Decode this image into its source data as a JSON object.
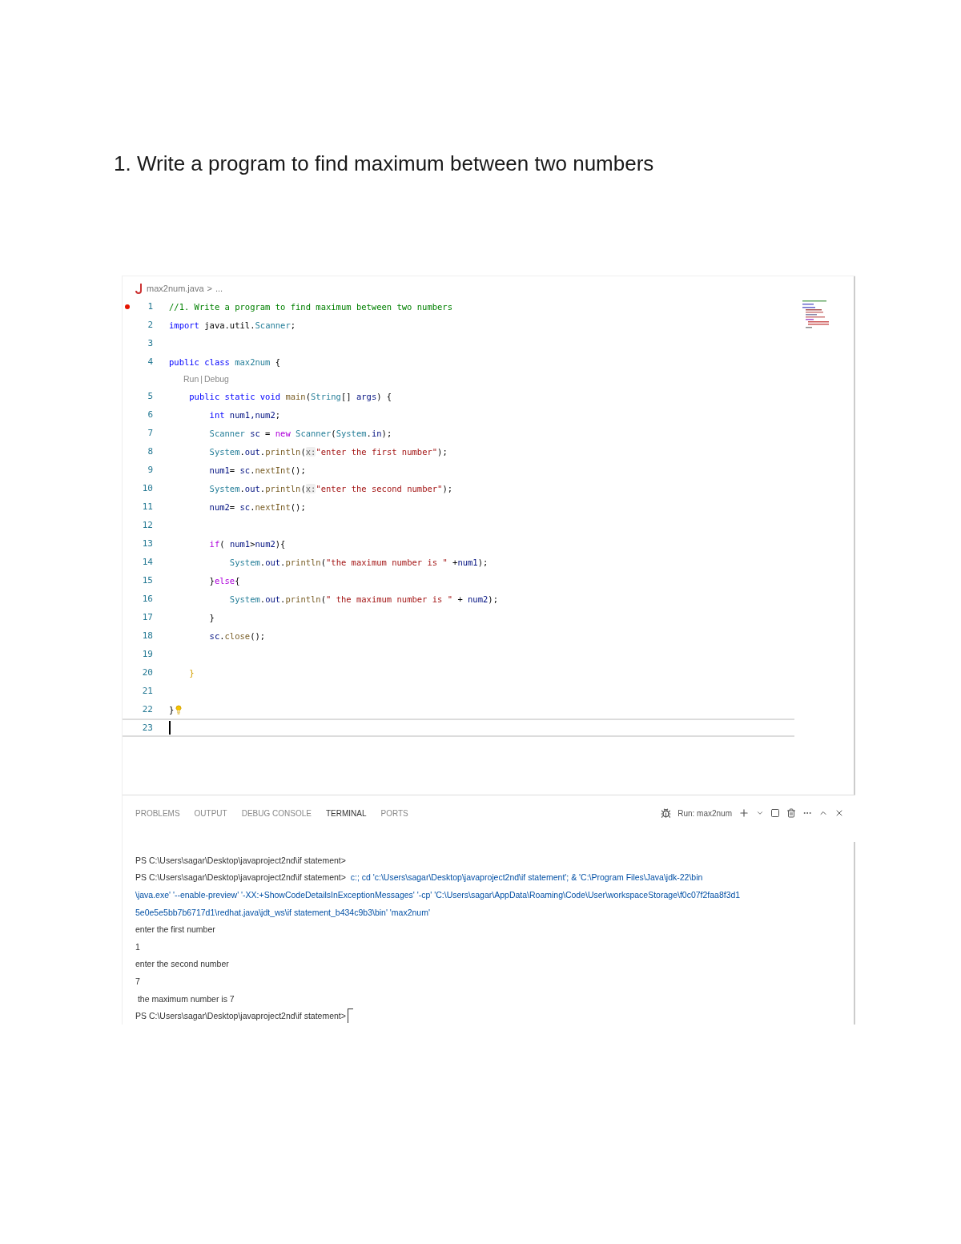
{
  "heading": "1. Write a program to find maximum between two numbers",
  "editor": {
    "breadcrumb": {
      "file": "max2num.java",
      "separator": ">",
      "rest": "..."
    },
    "lines": [
      {
        "kind": "code",
        "number": "1",
        "breakpoint": true,
        "current": false,
        "tokens": [
          {
            "kind": "comment",
            "text": "//1. Write a program to find maximum between two numbers"
          }
        ]
      },
      {
        "kind": "code",
        "number": "2",
        "breakpoint": false,
        "current": false,
        "tokens": [
          {
            "kind": "keyword",
            "text": "import"
          },
          {
            "kind": "plain",
            "text": " java.util."
          },
          {
            "kind": "type",
            "text": "Scanner"
          },
          {
            "kind": "plain",
            "text": ";"
          }
        ]
      },
      {
        "kind": "code",
        "number": "3",
        "breakpoint": false,
        "current": false
      },
      {
        "kind": "code",
        "number": "4",
        "breakpoint": false,
        "current": false,
        "tokens": [
          {
            "kind": "keyword",
            "text": "public class"
          },
          {
            "kind": "type",
            "text": " max2num"
          },
          {
            "kind": "plain",
            "text": " {"
          }
        ]
      },
      {
        "kind": "codelens",
        "links": [
          "Run",
          "Debug"
        ],
        "separator": "|"
      },
      {
        "kind": "code",
        "number": "5",
        "breakpoint": false,
        "current": false,
        "tokens": [
          {
            "kind": "keyword",
            "text": "    public static void"
          },
          {
            "kind": "function",
            "text": " main"
          },
          {
            "kind": "plain",
            "text": "("
          },
          {
            "kind": "type",
            "text": "String"
          },
          {
            "kind": "plain",
            "text": "[] "
          },
          {
            "kind": "variable",
            "text": "args"
          },
          {
            "kind": "plain",
            "text": ") {"
          }
        ]
      },
      {
        "kind": "code",
        "number": "6",
        "breakpoint": false,
        "current": false,
        "tokens": [
          {
            "kind": "keyword",
            "text": "        int"
          },
          {
            "kind": "variable",
            "text": " num1,num2"
          },
          {
            "kind": "plain",
            "text": ";"
          }
        ]
      },
      {
        "kind": "code",
        "number": "7",
        "breakpoint": false,
        "current": false,
        "tokens": [
          {
            "kind": "type",
            "text": "        Scanner"
          },
          {
            "kind": "variable",
            "text": " sc"
          },
          {
            "kind": "plain",
            "text": " = "
          },
          {
            "kind": "control",
            "text": "new"
          },
          {
            "kind": "type",
            "text": " Scanner"
          },
          {
            "kind": "plain",
            "text": "("
          },
          {
            "kind": "type",
            "text": "System"
          },
          {
            "kind": "plain",
            "text": "."
          },
          {
            "kind": "variable",
            "text": "in"
          },
          {
            "kind": "plain",
            "text": ");"
          }
        ]
      },
      {
        "kind": "code",
        "number": "8",
        "breakpoint": false,
        "current": false,
        "tokens": [
          {
            "kind": "type",
            "text": "        System"
          },
          {
            "kind": "plain",
            "text": "."
          },
          {
            "kind": "variable",
            "text": "out"
          },
          {
            "kind": "plain",
            "text": "."
          },
          {
            "kind": "function",
            "text": "println"
          },
          {
            "kind": "plain",
            "text": "("
          },
          {
            "kind": "hint",
            "text": "x:"
          },
          {
            "kind": "string",
            "text": "\"enter the first number\""
          },
          {
            "kind": "plain",
            "text": ");"
          }
        ]
      },
      {
        "kind": "code",
        "number": "9",
        "breakpoint": false,
        "current": false,
        "tokens": [
          {
            "kind": "variable",
            "text": "        num1"
          },
          {
            "kind": "plain",
            "text": "= "
          },
          {
            "kind": "variable",
            "text": "sc"
          },
          {
            "kind": "plain",
            "text": "."
          },
          {
            "kind": "function",
            "text": "nextInt"
          },
          {
            "kind": "plain",
            "text": "();"
          }
        ]
      },
      {
        "kind": "code",
        "number": "10",
        "breakpoint": false,
        "current": false,
        "tokens": [
          {
            "kind": "type",
            "text": "        System"
          },
          {
            "kind": "plain",
            "text": "."
          },
          {
            "kind": "variable",
            "text": "out"
          },
          {
            "kind": "plain",
            "text": "."
          },
          {
            "kind": "function",
            "text": "println"
          },
          {
            "kind": "plain",
            "text": "("
          },
          {
            "kind": "hint",
            "text": "x:"
          },
          {
            "kind": "string",
            "text": "\"enter the second number\""
          },
          {
            "kind": "plain",
            "text": ");"
          }
        ]
      },
      {
        "kind": "code",
        "number": "11",
        "breakpoint": false,
        "current": false,
        "tokens": [
          {
            "kind": "variable",
            "text": "        num2"
          },
          {
            "kind": "plain",
            "text": "= "
          },
          {
            "kind": "variable",
            "text": "sc"
          },
          {
            "kind": "plain",
            "text": "."
          },
          {
            "kind": "function",
            "text": "nextInt"
          },
          {
            "kind": "plain",
            "text": "();"
          }
        ]
      },
      {
        "kind": "code",
        "number": "12",
        "breakpoint": false,
        "current": false
      },
      {
        "kind": "code",
        "number": "13",
        "breakpoint": false,
        "current": false,
        "tokens": [
          {
            "kind": "control",
            "text": "        if"
          },
          {
            "kind": "plain",
            "text": "( "
          },
          {
            "kind": "variable",
            "text": "num1"
          },
          {
            "kind": "plain",
            "text": ">"
          },
          {
            "kind": "variable",
            "text": "num2"
          },
          {
            "kind": "plain",
            "text": "){"
          }
        ]
      },
      {
        "kind": "code",
        "number": "14",
        "breakpoint": false,
        "current": false,
        "tokens": [
          {
            "kind": "type",
            "text": "            System"
          },
          {
            "kind": "plain",
            "text": "."
          },
          {
            "kind": "variable",
            "text": "out"
          },
          {
            "kind": "plain",
            "text": "."
          },
          {
            "kind": "function",
            "text": "println"
          },
          {
            "kind": "plain",
            "text": "("
          },
          {
            "kind": "string",
            "text": "\"the maximum number is \""
          },
          {
            "kind": "plain",
            "text": " +"
          },
          {
            "kind": "variable",
            "text": "num1"
          },
          {
            "kind": "plain",
            "text": ");"
          }
        ]
      },
      {
        "kind": "code",
        "number": "15",
        "breakpoint": false,
        "current": false,
        "tokens": [
          {
            "kind": "plain",
            "text": "        }"
          },
          {
            "kind": "control",
            "text": "else"
          },
          {
            "kind": "plain",
            "text": "{"
          }
        ]
      },
      {
        "kind": "code",
        "number": "16",
        "breakpoint": false,
        "current": false,
        "tokens": [
          {
            "kind": "type",
            "text": "            System"
          },
          {
            "kind": "plain",
            "text": "."
          },
          {
            "kind": "variable",
            "text": "out"
          },
          {
            "kind": "plain",
            "text": "."
          },
          {
            "kind": "function",
            "text": "println"
          },
          {
            "kind": "plain",
            "text": "("
          },
          {
            "kind": "string",
            "text": "\" the maximum number is \""
          },
          {
            "kind": "plain",
            "text": " + "
          },
          {
            "kind": "variable",
            "text": "num2"
          },
          {
            "kind": "plain",
            "text": ");"
          }
        ]
      },
      {
        "kind": "code",
        "number": "17",
        "breakpoint": false,
        "current": false,
        "tokens": [
          {
            "kind": "plain",
            "text": "        }"
          }
        ]
      },
      {
        "kind": "code",
        "number": "18",
        "breakpoint": false,
        "current": false,
        "tokens": [
          {
            "kind": "variable",
            "text": "        sc"
          },
          {
            "kind": "plain",
            "text": "."
          },
          {
            "kind": "function",
            "text": "close"
          },
          {
            "kind": "plain",
            "text": "();"
          }
        ]
      },
      {
        "kind": "code",
        "number": "19",
        "breakpoint": false,
        "current": false
      },
      {
        "kind": "code",
        "number": "20",
        "breakpoint": false,
        "current": false,
        "tokens": [
          {
            "kind": "bracket",
            "text": "    }"
          }
        ]
      },
      {
        "kind": "code",
        "number": "21",
        "breakpoint": false,
        "current": false
      },
      {
        "kind": "code",
        "number": "22",
        "breakpoint": false,
        "current": false,
        "tokens": [
          {
            "kind": "plain",
            "text": "}"
          }
        ],
        "lightbulb": true
      },
      {
        "kind": "code",
        "number": "23",
        "breakpoint": false,
        "current": true
      }
    ]
  },
  "panel": {
    "tabs": [
      {
        "label": "PROBLEMS",
        "selected": false
      },
      {
        "label": "OUTPUT",
        "selected": false
      },
      {
        "label": "DEBUG CONSOLE",
        "selected": false
      },
      {
        "label": "TERMINAL",
        "selected": true
      },
      {
        "label": "PORTS",
        "selected": false
      }
    ],
    "terminal_name": "Run: max2num",
    "terminal": [
      {
        "segments": [
          {
            "kind": "output",
            "text": "PS C:\\Users\\sagar\\Desktop\\javaproject2nd\\if statement>"
          }
        ]
      },
      {
        "segments": [
          {
            "kind": "output",
            "text": "PS C:\\Users\\sagar\\Desktop\\javaproject2nd\\if statement>"
          },
          {
            "kind": "command",
            "text": "  c:; cd 'c:\\Users\\sagar\\Desktop\\javaproject2nd\\if statement'; & 'C:\\Program Files\\Java\\jdk-22\\bin"
          }
        ]
      },
      {
        "segments": [
          {
            "kind": "command",
            "text": "\\java.exe' '--enable-preview' '-XX:+ShowCodeDetailsInExceptionMessages' '-cp' 'C:\\Users\\sagar\\AppData\\Roaming\\Code\\User\\workspaceStorage\\f0c07f2faa8f3d1"
          }
        ]
      },
      {
        "segments": [
          {
            "kind": "command",
            "text": "5e0e5e5bb7b6717d1\\redhat.java\\jdt_ws\\if statement_b434c9b3\\bin' 'max2num'"
          }
        ]
      },
      {
        "segments": [
          {
            "kind": "output",
            "text": "enter the first number"
          }
        ]
      },
      {
        "segments": [
          {
            "kind": "output",
            "text": "1"
          }
        ]
      },
      {
        "segments": [
          {
            "kind": "output",
            "text": "enter the second number"
          }
        ]
      },
      {
        "segments": [
          {
            "kind": "output",
            "text": "7"
          }
        ]
      },
      {
        "segments": [
          {
            "kind": "output",
            "text": " the maximum number is 7"
          }
        ]
      },
      {
        "segments": [
          {
            "kind": "output",
            "text": "PS C:\\Users\\sagar\\Desktop\\javaproject2nd\\if statement>"
          }
        ],
        "cursor": true
      }
    ]
  }
}
